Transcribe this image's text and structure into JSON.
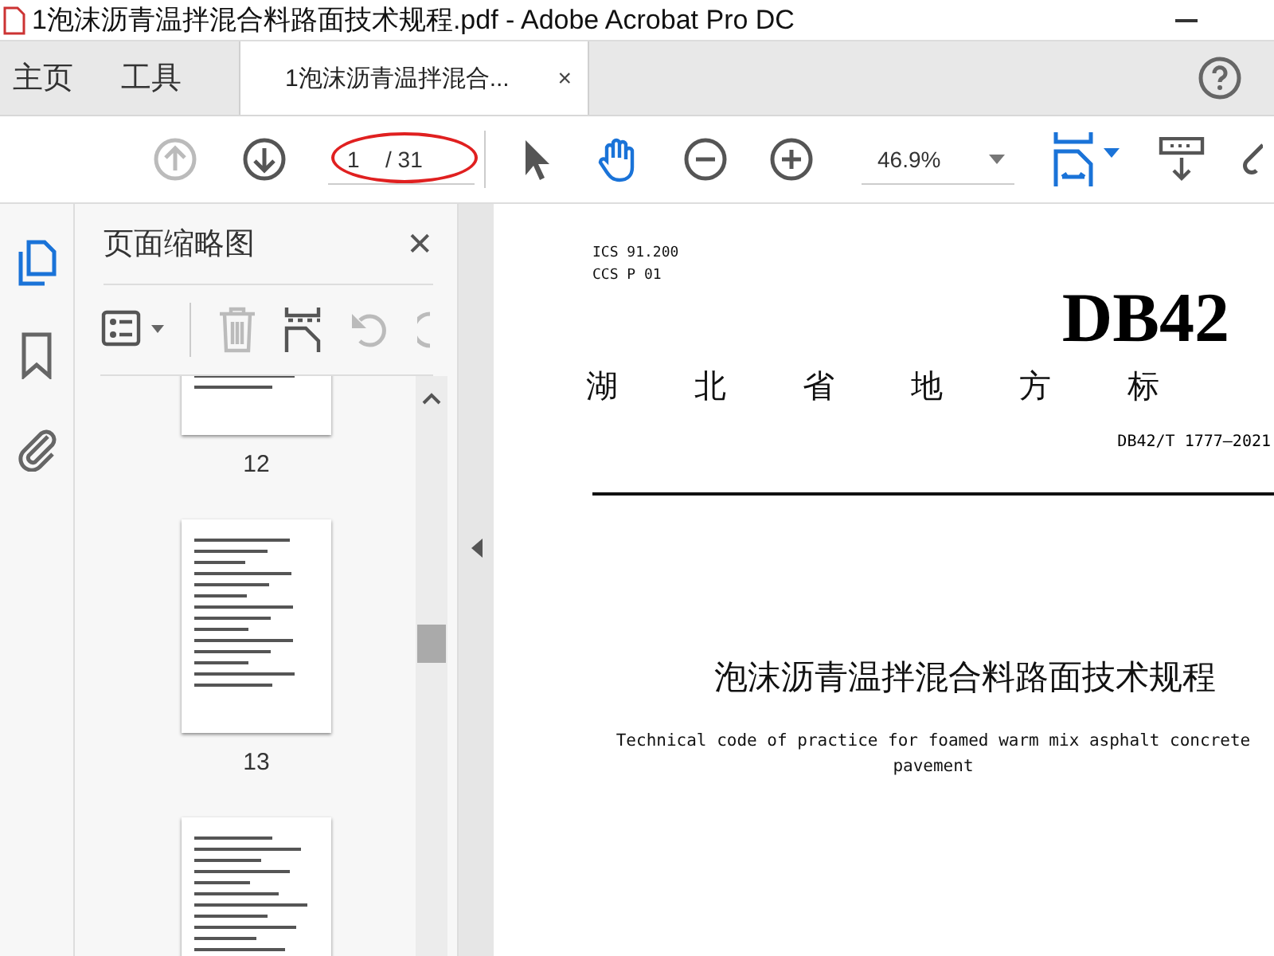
{
  "window": {
    "title": "1泡沫沥青温拌混合料路面技术规程.pdf - Adobe Acrobat Pro DC"
  },
  "tabs": [
    {
      "label": "主页",
      "selected": false,
      "kind": "nav"
    },
    {
      "label": "工具",
      "selected": false,
      "kind": "nav"
    },
    {
      "label": "1泡沫沥青温拌混合...",
      "selected": true,
      "kind": "document",
      "close": "×"
    }
  ],
  "toolbar": {
    "buttons": [
      {
        "kind": "previous-page",
        "disabled": true
      },
      {
        "kind": "next-page",
        "disabled": false
      }
    ],
    "page_current": "1",
    "page_total": "/ 31",
    "zoom": "46.9%"
  },
  "side_rail": [
    {
      "kind": "pages",
      "selected": true
    },
    {
      "kind": "bookmarks",
      "selected": false
    },
    {
      "kind": "attachments",
      "selected": false
    }
  ],
  "thumbnail_panel": {
    "title": "页面缩略图",
    "close": "✕",
    "pages": [
      {
        "label": "12"
      },
      {
        "label": "13"
      }
    ]
  },
  "document": {
    "ics": "ICS  91.200",
    "ccs": "CCS  P 01",
    "code": "DB42",
    "heading": [
      "湖",
      "北",
      "省",
      "地",
      "方",
      "标"
    ],
    "number": "DB42/T 1777—2021",
    "title": "泡沫沥青温拌混合料路面技术规程",
    "subtitle": "Technical code of practice for foamed warm mix asphalt concrete pavement"
  }
}
